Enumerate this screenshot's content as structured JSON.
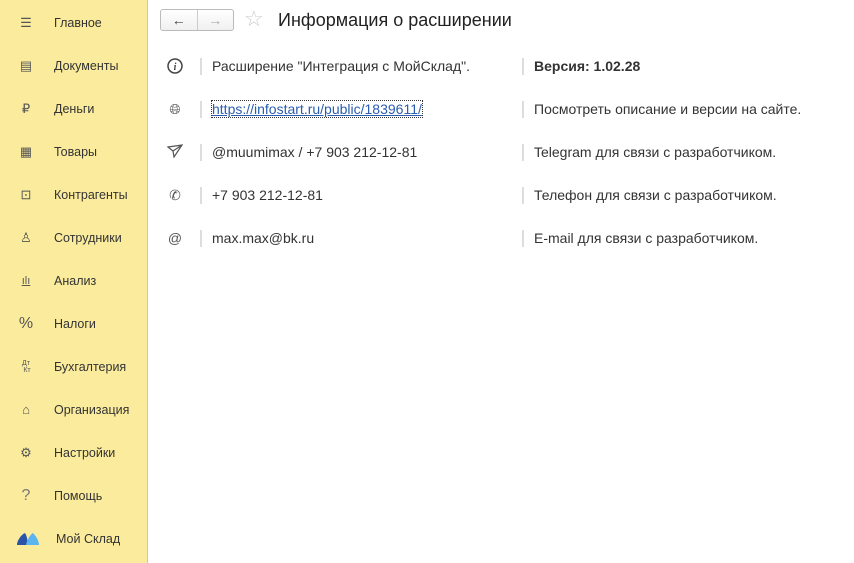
{
  "sidebar": {
    "items": [
      {
        "label": "Главное",
        "icon": "menu-icon"
      },
      {
        "label": "Документы",
        "icon": "document-icon"
      },
      {
        "label": "Деньги",
        "icon": "ruble-icon"
      },
      {
        "label": "Товары",
        "icon": "goods-icon"
      },
      {
        "label": "Контрагенты",
        "icon": "briefcase-icon"
      },
      {
        "label": "Сотрудники",
        "icon": "person-icon"
      },
      {
        "label": "Анализ",
        "icon": "chart-icon"
      },
      {
        "label": "Налоги",
        "icon": "percent-icon"
      },
      {
        "label": "Бухгалтерия",
        "icon": "dt-kt-icon"
      },
      {
        "label": "Организация",
        "icon": "home-icon"
      },
      {
        "label": "Настройки",
        "icon": "gear-icon"
      },
      {
        "label": "Помощь",
        "icon": "help-icon"
      },
      {
        "label": "Мой Склад",
        "icon": "moysklad-logo-icon"
      }
    ]
  },
  "header": {
    "title": "Информация о расширении",
    "back": "←",
    "forward": "→",
    "star": "☆"
  },
  "rows": [
    {
      "icon": "info-icon",
      "value": "Расширение \"Интеграция с МойСклад\".",
      "desc": "Версия: 1.02.28"
    },
    {
      "icon": "web-icon",
      "value": "https://infostart.ru/public/1839611/",
      "desc": "Посмотреть описание и версии на сайте."
    },
    {
      "icon": "telegram-icon",
      "value": "@muumimax / +7 903 212-12-81",
      "desc": "Telegram для связи с разработчиком."
    },
    {
      "icon": "phone-icon",
      "value": "+7 903 212-12-81",
      "desc": "Телефон для связи с разработчиком."
    },
    {
      "icon": "email-icon",
      "value": "max.max@bk.ru",
      "desc": "E-mail для связи с разработчиком."
    }
  ]
}
